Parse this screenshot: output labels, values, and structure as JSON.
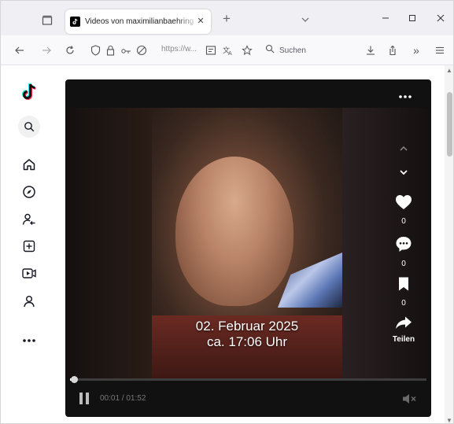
{
  "browser": {
    "tab": {
      "title": "Videos von maximilianbaehring",
      "close": "✕"
    },
    "new_tab": "+",
    "address": {
      "url_visible": "https://w..."
    },
    "search_placeholder": "Suchen",
    "overflow": "»"
  },
  "player": {
    "caption_line1": "02. Februar 2025",
    "caption_line2": "ca. 17:06 Uhr",
    "time": "00:01 / 01:52",
    "progress": 0.01,
    "likes": "0",
    "comments": "0",
    "saves": "0",
    "share_label": "Teilen"
  },
  "icons": {
    "tiktok_logo": "tiktok-logo-icon",
    "sidebar": [
      "search-icon",
      "home-icon",
      "explore-icon",
      "following-icon",
      "upload-icon",
      "live-icon",
      "profile-icon",
      "more-icon"
    ]
  },
  "colors": {
    "tab_strip": "#f0f0f4",
    "toolbar": "#f9f9fb",
    "player_bg": "#111111",
    "text_primary": "#161823"
  }
}
